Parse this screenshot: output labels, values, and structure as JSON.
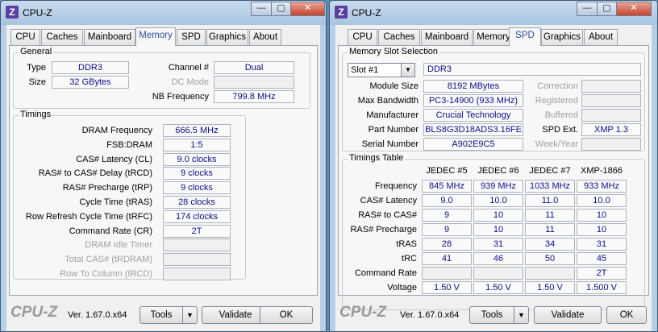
{
  "window1": {
    "title": "CPU-Z",
    "app_icon": "Z",
    "caption": {
      "minimize": "—",
      "maximize": "▢",
      "close": "✕"
    },
    "tabs": [
      "CPU",
      "Caches",
      "Mainboard",
      "Memory",
      "SPD",
      "Graphics",
      "About"
    ],
    "active_tab": "Memory",
    "general": {
      "title": "General",
      "type_label": "Type",
      "type_value": "DDR3",
      "size_label": "Size",
      "size_value": "32 GBytes",
      "channel_label": "Channel #",
      "channel_value": "Dual",
      "dcmode_label": "DC Mode",
      "dcmode_value": "",
      "nbfreq_label": "NB Frequency",
      "nbfreq_value": "799.8 MHz"
    },
    "timings": {
      "title": "Timings",
      "rows": [
        {
          "label": "DRAM Frequency",
          "value": "666.5 MHz",
          "dim": false
        },
        {
          "label": "FSB:DRAM",
          "value": "1:5",
          "dim": false
        },
        {
          "label": "CAS# Latency (CL)",
          "value": "9.0 clocks",
          "dim": false
        },
        {
          "label": "RAS# to CAS# Delay (tRCD)",
          "value": "9 clocks",
          "dim": false
        },
        {
          "label": "RAS# Precharge (tRP)",
          "value": "9 clocks",
          "dim": false
        },
        {
          "label": "Cycle Time (tRAS)",
          "value": "28 clocks",
          "dim": false
        },
        {
          "label": "Row Refresh Cycle Time (tRFC)",
          "value": "174 clocks",
          "dim": false
        },
        {
          "label": "Command Rate (CR)",
          "value": "2T",
          "dim": false
        },
        {
          "label": "DRAM Idle Timer",
          "value": "",
          "dim": true
        },
        {
          "label": "Total CAS# (tRDRAM)",
          "value": "",
          "dim": true
        },
        {
          "label": "Row To Column (tRCD)",
          "value": "",
          "dim": true
        }
      ]
    },
    "footer": {
      "logo": "CPU-Z",
      "version": "Ver. 1.67.0.x64",
      "tools": "Tools",
      "tools_arrow": "▼",
      "validate": "Validate",
      "ok": "OK"
    }
  },
  "window2": {
    "title": "CPU-Z",
    "app_icon": "Z",
    "caption": {
      "minimize": "—",
      "maximize": "▢",
      "close": "✕"
    },
    "tabs": [
      "CPU",
      "Caches",
      "Mainboard",
      "Memory",
      "SPD",
      "Graphics",
      "About"
    ],
    "active_tab": "SPD",
    "slot_selection": {
      "title": "Memory Slot Selection",
      "slot": "Slot #1",
      "slot_arrow": "▼",
      "type": "DDR3",
      "module_size_label": "Module Size",
      "module_size": "8192 MBytes",
      "max_bandwidth_label": "Max Bandwidth",
      "max_bandwidth": "PC3-14900 (933 MHz)",
      "manufacturer_label": "Manufacturer",
      "manufacturer": "Crucial Technology",
      "part_number_label": "Part Number",
      "part_number": "BLS8G3D18ADS3.16FE",
      "serial_number_label": "Serial Number",
      "serial_number": "A902E9C5",
      "correction_label": "Correction",
      "correction": "",
      "registered_label": "Registered",
      "registered": "",
      "buffered_label": "Buffered",
      "buffered": "",
      "spd_ext_label": "SPD Ext.",
      "spd_ext": "XMP 1.3",
      "week_year_label": "Week/Year",
      "week_year": ""
    },
    "timings_table": {
      "title": "Timings Table",
      "columns": [
        "JEDEC #5",
        "JEDEC #6",
        "JEDEC #7",
        "XMP-1866"
      ],
      "rows": [
        {
          "label": "Frequency",
          "cells": [
            "845 MHz",
            "939 MHz",
            "1033 MHz",
            "933 MHz"
          ]
        },
        {
          "label": "CAS# Latency",
          "cells": [
            "9.0",
            "10.0",
            "11.0",
            "10.0"
          ]
        },
        {
          "label": "RAS# to CAS#",
          "cells": [
            "9",
            "10",
            "11",
            "10"
          ]
        },
        {
          "label": "RAS# Precharge",
          "cells": [
            "9",
            "10",
            "11",
            "10"
          ]
        },
        {
          "label": "tRAS",
          "cells": [
            "28",
            "31",
            "34",
            "31"
          ]
        },
        {
          "label": "tRC",
          "cells": [
            "41",
            "46",
            "50",
            "45"
          ]
        },
        {
          "label": "Command Rate",
          "cells": [
            "",
            "",
            "",
            "2T"
          ]
        },
        {
          "label": "Voltage",
          "cells": [
            "1.50 V",
            "1.50 V",
            "1.50 V",
            "1.500 V"
          ]
        }
      ]
    },
    "footer": {
      "logo": "CPU-Z",
      "version": "Ver. 1.67.0.x64",
      "tools": "Tools",
      "tools_arrow": "▼",
      "validate": "Validate",
      "ok": "OK"
    }
  }
}
